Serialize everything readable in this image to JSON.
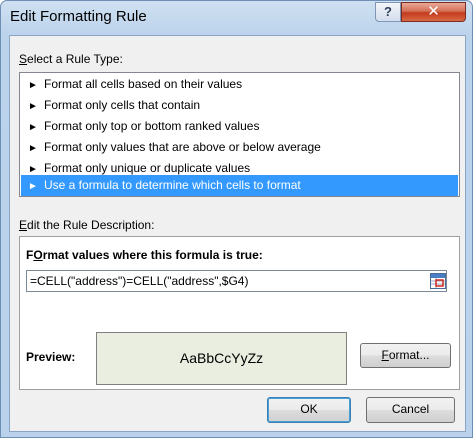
{
  "window": {
    "title": "Edit Formatting Rule",
    "help_label": "?",
    "close_label": "✕"
  },
  "rule_type": {
    "label_accel": "S",
    "label_rest": "elect a Rule Type:",
    "items": [
      {
        "label": "Format all cells based on their values",
        "selected": false
      },
      {
        "label": "Format only cells that contain",
        "selected": false
      },
      {
        "label": "Format only top or bottom ranked values",
        "selected": false
      },
      {
        "label": "Format only values that are above or below average",
        "selected": false
      },
      {
        "label": "Format only unique or duplicate values",
        "selected": false
      },
      {
        "label": "Use a formula to determine which cells to format",
        "selected": true
      }
    ],
    "bullet": "►",
    "selection_color": "#3399ff"
  },
  "description": {
    "label_accel": "E",
    "label_rest": "dit the Rule Description:",
    "heading_accel": "O",
    "heading_pre": "F",
    "heading_rest": "rmat values where this formula is true:",
    "formula_value": "=CELL(\"address\")=CELL(\"address\",$G4)",
    "ref_icon": "range-select-icon",
    "preview_label": "Preview:",
    "preview_sample": "AaBbCcYyZz",
    "preview_bg": "#eaeee0",
    "format_button_accel": "F",
    "format_button_rest": "ormat..."
  },
  "footer": {
    "ok_label": "OK",
    "cancel_label": "Cancel"
  }
}
